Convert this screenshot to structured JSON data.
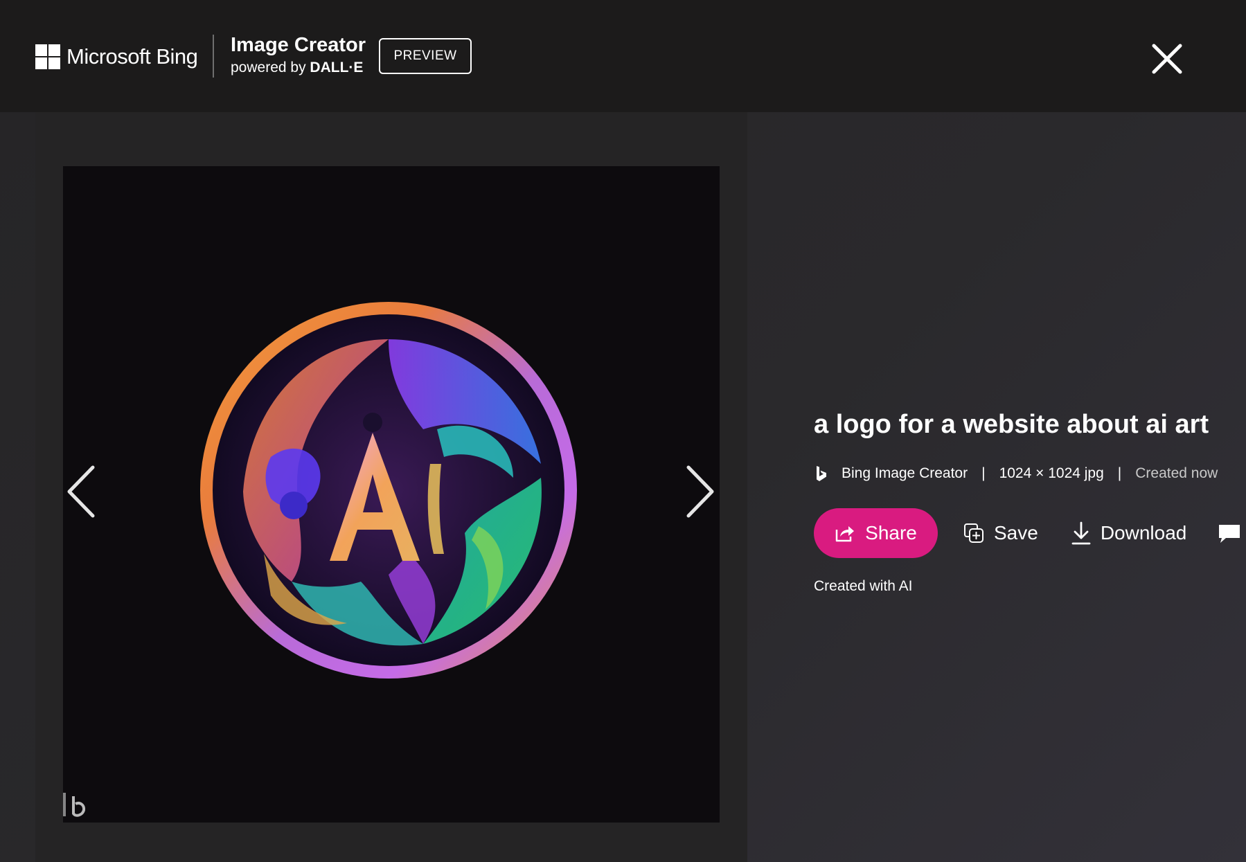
{
  "header": {
    "brand_name": "Microsoft Bing",
    "product_title": "Image Creator",
    "product_sub_prefix": "powered by",
    "product_sub_engine": "DALL·E",
    "badge": "PREVIEW"
  },
  "viewer": {
    "image_subject_text": "AI",
    "prev_icon": "chevron-left-icon",
    "next_icon": "chevron-right-icon",
    "close_icon": "close-icon"
  },
  "details": {
    "prompt_title": "a logo for a website about ai art",
    "source": "Bing Image Creator",
    "separator": "|",
    "dimensions": "1024 × 1024 jpg",
    "created": "Created now",
    "created_with": "Created with AI"
  },
  "actions": {
    "share_label": "Share",
    "save_label": "Save",
    "download_label": "Download"
  },
  "colors": {
    "accent": "#d91b80",
    "background": "#1c1b1c"
  }
}
